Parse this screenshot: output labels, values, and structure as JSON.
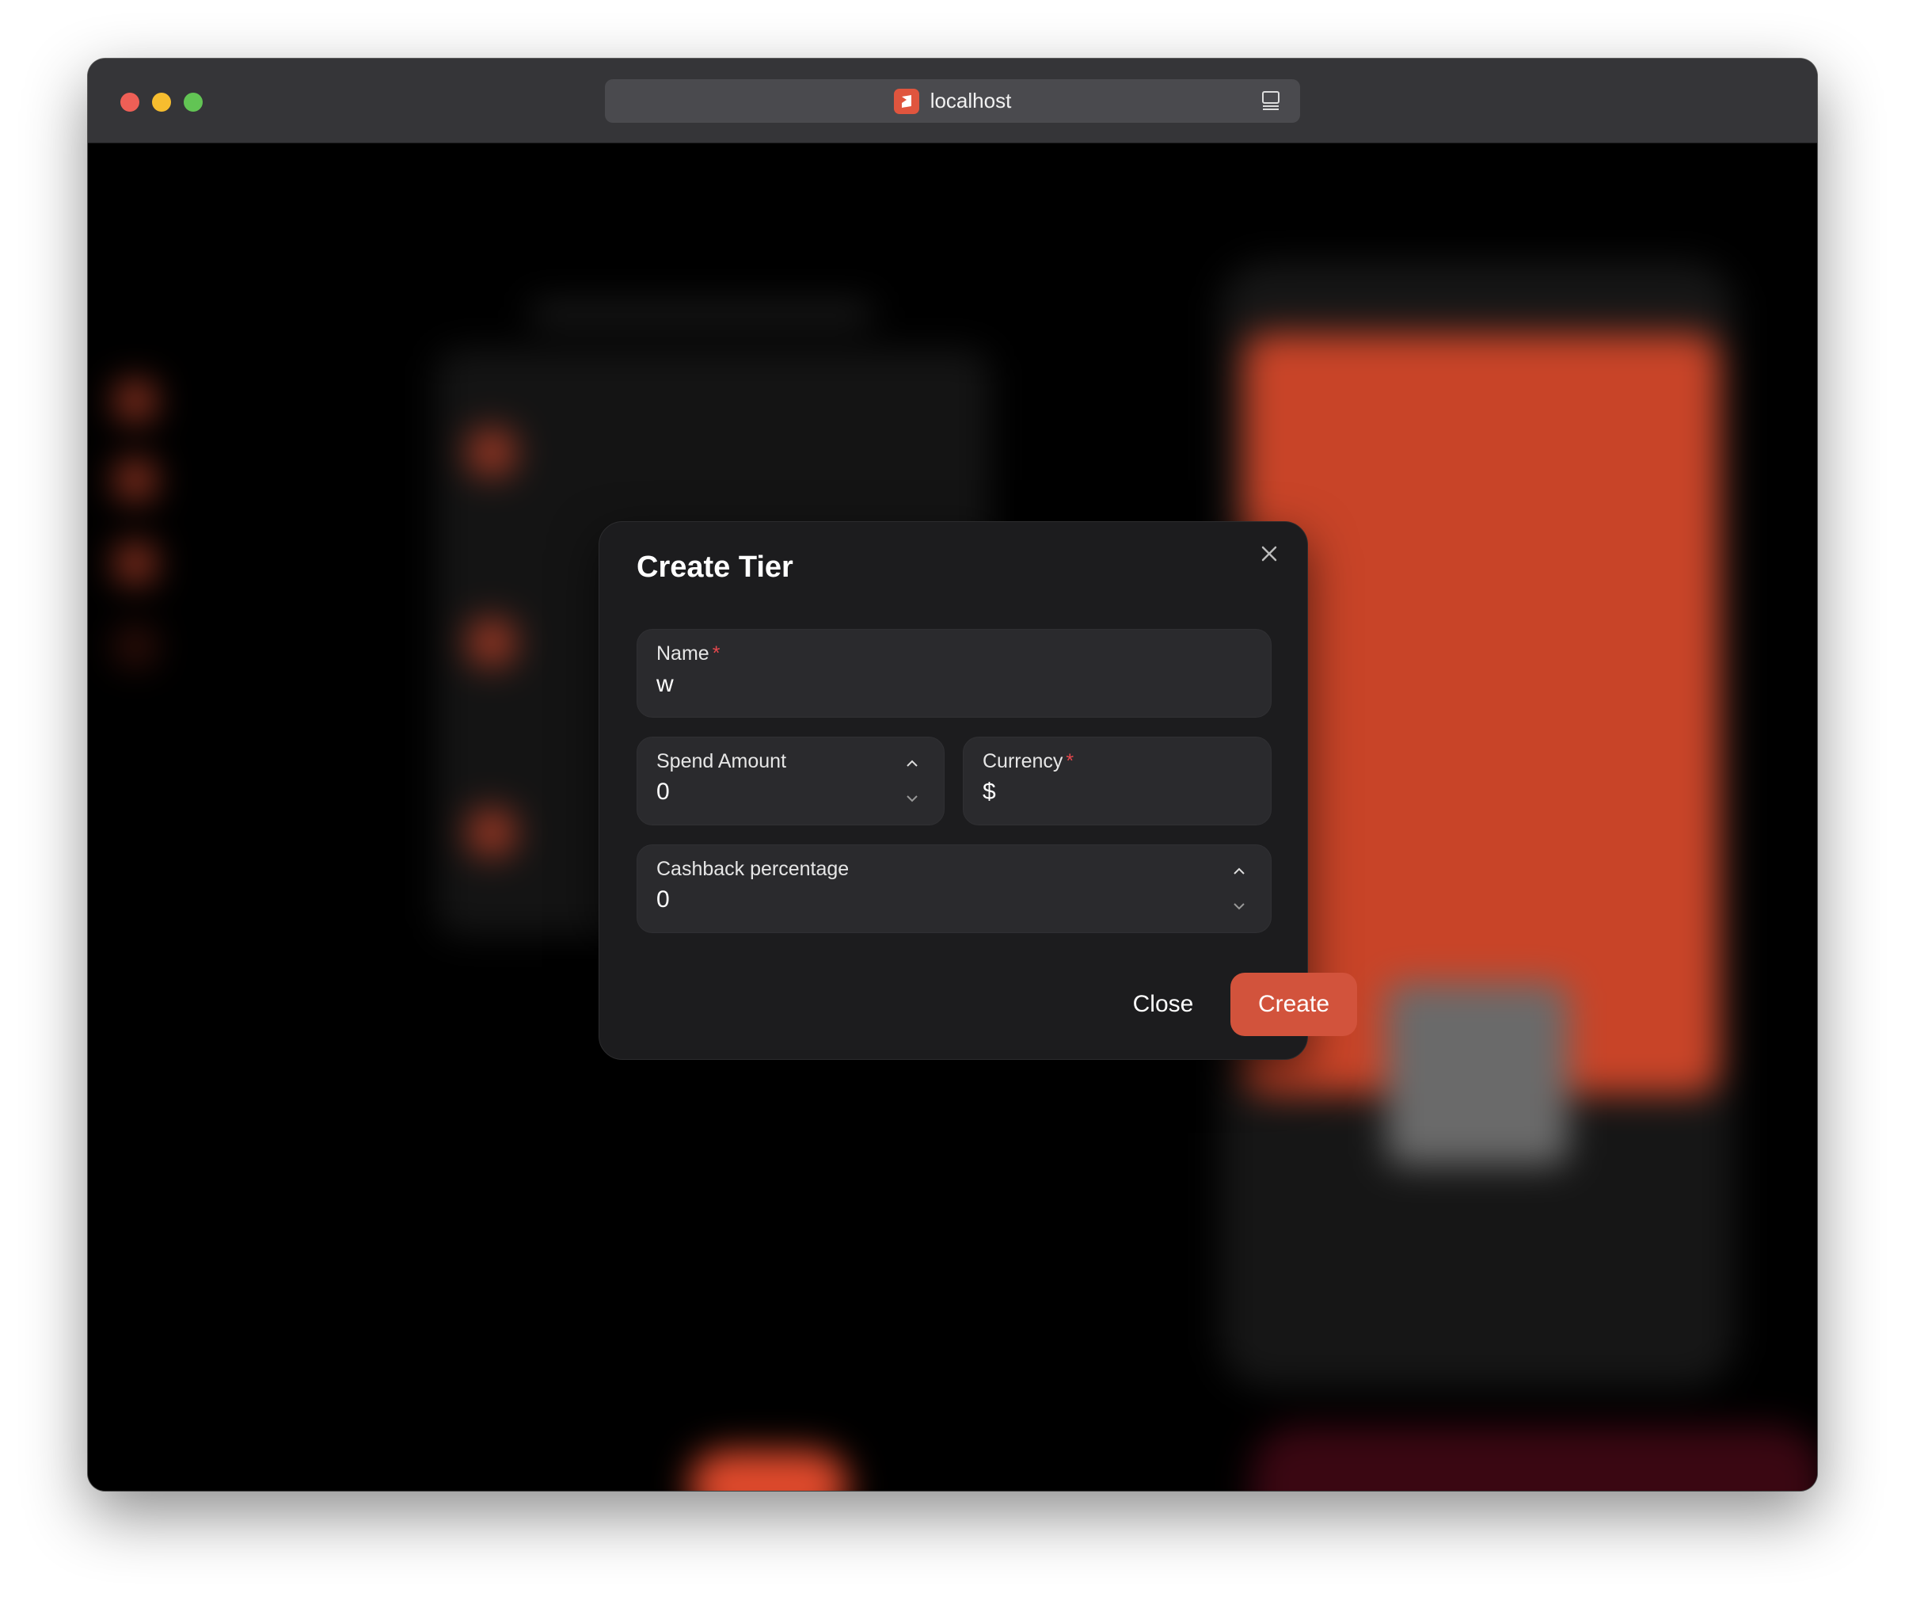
{
  "browser": {
    "url": "localhost"
  },
  "modal": {
    "title": "Create Tier",
    "fields": {
      "name": {
        "label": "Name",
        "required_mark": "*",
        "value": "w"
      },
      "spend_amount": {
        "label": "Spend Amount",
        "value": "0"
      },
      "currency": {
        "label": "Currency",
        "required_mark": "*",
        "value": "$"
      },
      "cashback_percentage": {
        "label": "Cashback percentage",
        "value": "0"
      }
    },
    "buttons": {
      "close_label": "Close",
      "create_label": "Create"
    }
  },
  "colors": {
    "accent": "#d2533c",
    "required": "#e5484d",
    "modal_bg": "#1c1c1e",
    "field_bg": "#2a2a2d"
  }
}
